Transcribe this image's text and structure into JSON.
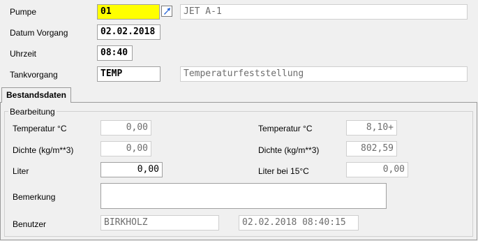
{
  "header": {
    "pumpe_label": "Pumpe",
    "pumpe_value": "01",
    "pumpe_name": "JET A-1",
    "datum_label": "Datum Vorgang",
    "datum_value": "02.02.2018",
    "uhrzeit_label": "Uhrzeit",
    "uhrzeit_value": "08:40",
    "tankvorgang_label": "Tankvorgang",
    "tankvorgang_value": "TEMP",
    "tankvorgang_desc": "Temperaturfeststellung"
  },
  "tabs": [
    {
      "label": "Bestandsdaten",
      "active": true
    }
  ],
  "group": {
    "title": "Bearbeitung",
    "left": {
      "temperatur_label": "Temperatur °C",
      "temperatur_value": "0,00",
      "dichte_label": "Dichte (kg/m**3)",
      "dichte_value": "0,00",
      "liter_label": "Liter",
      "liter_value": "0,00"
    },
    "right": {
      "temperatur_label": "Temperatur °C",
      "temperatur_value": "8,10+",
      "dichte_label": "Dichte (kg/m**3)",
      "dichte_value": "802,59",
      "liter15_label": "Liter bei 15°C",
      "liter15_value": "0,00"
    },
    "bemerkung_label": "Bemerkung",
    "bemerkung_value": "",
    "benutzer_label": "Benutzer",
    "benutzer_value": "BIRKHOLZ",
    "timestamp_value": "02.02.2018 08:40:15"
  },
  "colors": {
    "highlight": "#ffff00",
    "lookup_icon": "#1f5fd6"
  },
  "icons": {
    "lookup": "arrow-lookup-icon"
  }
}
